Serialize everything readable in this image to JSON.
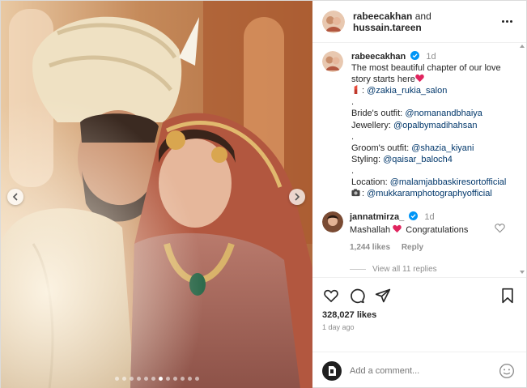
{
  "header": {
    "user1": "rabeecakhan",
    "conj": "and",
    "user2": "hussain.tareen"
  },
  "caption": {
    "username": "rabeecakhan",
    "time": "1d",
    "line1": "The most beautiful chapter of our love story starts here",
    "salon_link": "@zakia_rukia_salon",
    "dot1": ".",
    "brides_outfit_label": "Bride's outfit:",
    "brides_outfit_link": "@nomanandbhaiya",
    "jewellery_label": "Jewellery:",
    "jewellery_link": "@opalbymadihahsan",
    "dot2": ".",
    "grooms_outfit_label": "Groom's outfit:",
    "grooms_outfit_link": "@shazia_kiyani",
    "styling_label": "Styling:",
    "styling_link": "@qaisar_baloch4",
    "dot3": ".",
    "location_label": "Location:",
    "location_link": "@malamjabbaskiresortofficial",
    "camera_link": "@mukkaramphotographyofficial"
  },
  "comment": {
    "username": "jannatmirza_",
    "time": "1d",
    "text_before": "Mashallah",
    "text_after": "Congratulations",
    "likes": "1,244 likes",
    "reply": "Reply",
    "view_replies": "View all 11 replies"
  },
  "actions": {
    "likes": "328,027 likes",
    "ago": "1 day ago"
  },
  "add_comment": {
    "placeholder": "Add a comment..."
  },
  "carousel": {
    "slide_count": 12,
    "active_index": 6
  },
  "colors": {
    "link": "#00376b",
    "verified": "#0095f6",
    "heart": "#ed4956"
  }
}
